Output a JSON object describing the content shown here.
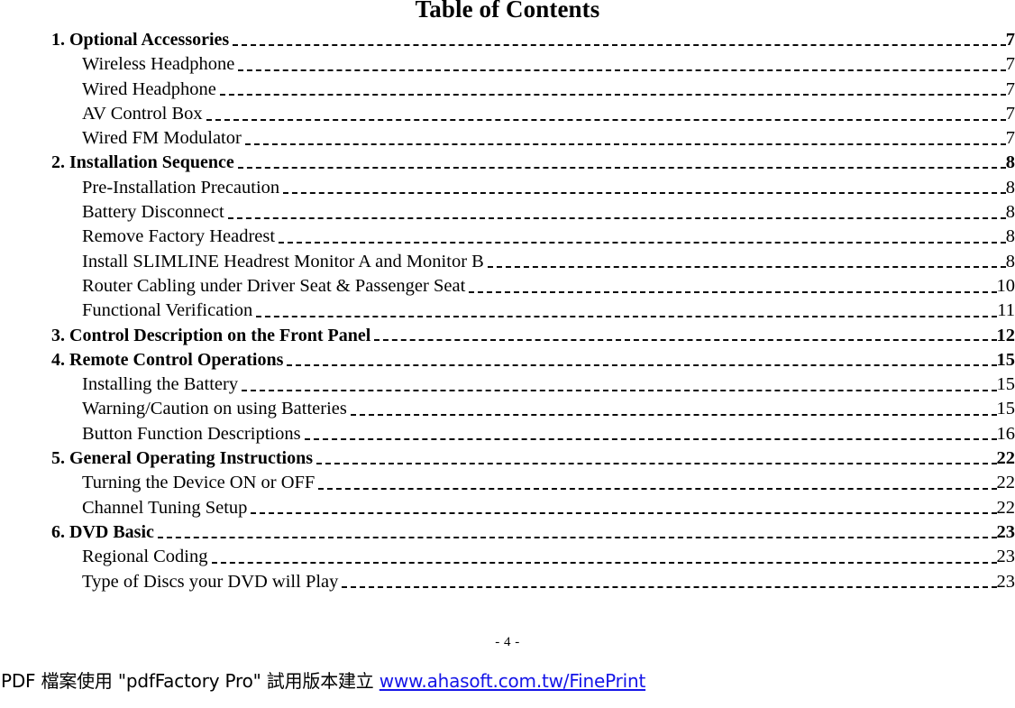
{
  "document": {
    "title": "Table of Contents",
    "folio": "- 4 -"
  },
  "toc": {
    "entries": [
      {
        "label": "1. Optional Accessories",
        "page": "7",
        "level": 1
      },
      {
        "label": "Wireless Headphone",
        "page": "7",
        "level": 2
      },
      {
        "label": "Wired Headphone",
        "page": "7",
        "level": 2
      },
      {
        "label": "AV Control Box",
        "page": "7",
        "level": 2
      },
      {
        "label": "Wired FM Modulator",
        "page": "7",
        "level": 2
      },
      {
        "label": "2. Installation Sequence",
        "page": "8",
        "level": 1
      },
      {
        "label": "Pre-Installation Precaution",
        "page": "8",
        "level": 2
      },
      {
        "label": "Battery Disconnect",
        "page": "8",
        "level": 2
      },
      {
        "label": "Remove Factory Headrest",
        "page": "8",
        "level": 2
      },
      {
        "label": "Install SLIMLINE Headrest Monitor A and Monitor B",
        "page": "8",
        "level": 2
      },
      {
        "label": "Router Cabling under Driver Seat & Passenger Seat",
        "page": "10",
        "level": 2
      },
      {
        "label": "Functional Verification",
        "page": "11",
        "level": 2
      },
      {
        "label": "3. Control Description on the Front Panel",
        "page": "12",
        "level": 1
      },
      {
        "label": "4. Remote Control Operations",
        "page": "15",
        "level": 1
      },
      {
        "label": "Installing the Battery",
        "page": "15",
        "level": 2
      },
      {
        "label": "Warning/Caution on using Batteries",
        "page": "15",
        "level": 2
      },
      {
        "label": "Button Function Descriptions",
        "page": "16",
        "level": 2
      },
      {
        "label": "5. General Operating Instructions",
        "page": "22",
        "level": 1
      },
      {
        "label": "Turning the Device ON or OFF",
        "page": "22",
        "level": 2
      },
      {
        "label": "Channel Tuning Setup",
        "page": "22",
        "level": 2
      },
      {
        "label": "6. DVD Basic",
        "page": "23",
        "level": 1
      },
      {
        "label": "Regional Coding",
        "page": "23",
        "level": 2
      },
      {
        "label": "Type of Discs your DVD will Play",
        "page": "23",
        "level": 2
      }
    ]
  },
  "watermark": {
    "text": "PDF 檔案使用 \"pdfFactory Pro\" 試用版本建立 ",
    "url_text": "www.ahasoft.com.tw/FinePrint",
    "url_color": "#1414e8"
  }
}
